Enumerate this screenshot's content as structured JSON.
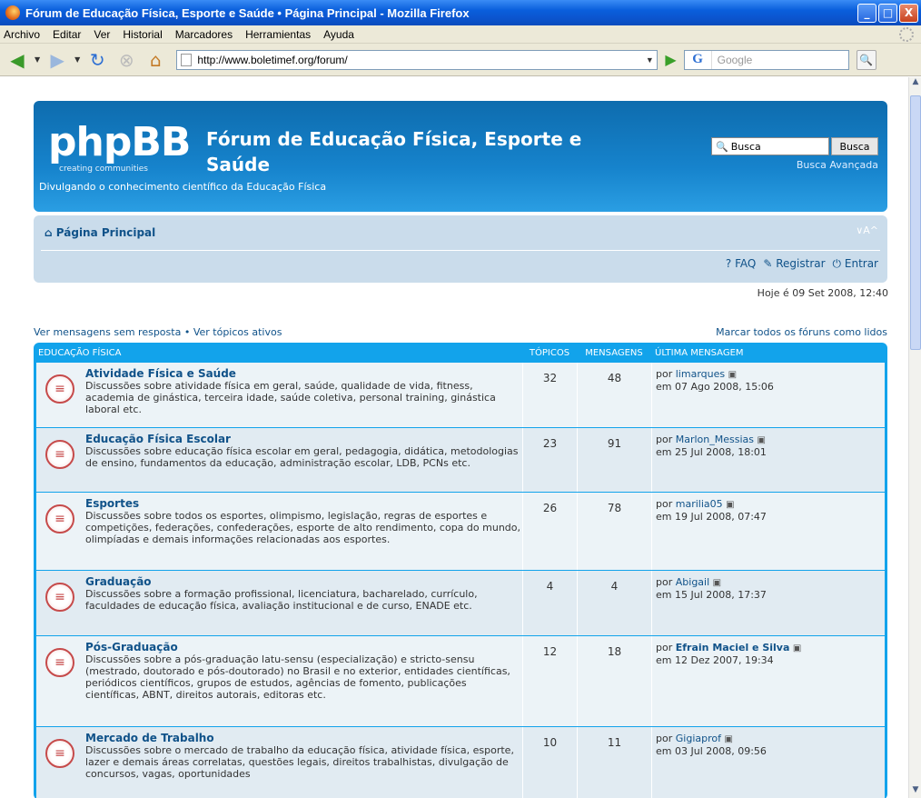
{
  "window": {
    "title": "Fórum de Educação Física, Esporte e Saúde • Página Principal - Mozilla Firefox",
    "btn_min": "_",
    "btn_max": "□",
    "btn_close": "X"
  },
  "menu": [
    {
      "label": "Archivo"
    },
    {
      "label": "Editar"
    },
    {
      "label": "Ver"
    },
    {
      "label": "Historial"
    },
    {
      "label": "Marcadores"
    },
    {
      "label": "Herramientas"
    },
    {
      "label": "Ayuda"
    }
  ],
  "toolbar": {
    "url": "http://www.boletimef.org/forum/",
    "search_placeholder": "Google",
    "search_engine": "G"
  },
  "forum": {
    "logo": "phpBB",
    "logo_sub": "creating  communities",
    "site_title": "Fórum de Educação Física, Esporte e Saúde",
    "site_desc": "Divulgando o conhecimento científico da Educação Física",
    "search_value": "Busca",
    "search_button": "Busca",
    "advanced_search": "Busca Avançada",
    "home_link": "Página Principal",
    "font_size": "∨A^",
    "faq": "FAQ",
    "register": "Registrar",
    "login": "Entrar",
    "date": "Hoje é 09 Set 2008, 12:40",
    "unanswered": "Ver mensagens sem resposta",
    "separator": "•",
    "active": "Ver tópicos ativos",
    "mark_read": "Marcar todos os fóruns como lidos"
  },
  "table": {
    "headers": {
      "name": "Educação Física",
      "topics": "Tópicos",
      "posts": "Mensagens",
      "last": "Última mensagem"
    },
    "rows": [
      {
        "title": "Atividade Física e Saúde",
        "desc": "Discussões sobre atividade física em geral, saúde, qualidade de vida, fitness, academia de ginástica, terceira idade, saúde coletiva, personal training, ginástica laboral etc.",
        "topics": "32",
        "posts": "48",
        "by": "por",
        "user": "limarques",
        "date": "em 07 Ago 2008, 15:06"
      },
      {
        "title": "Educação Física Escolar",
        "desc": "Discussões sobre educação física escolar em geral, pedagogia, didática, metodologias de ensino, fundamentos da educação, administração escolar, LDB, PCNs etc.",
        "topics": "23",
        "posts": "91",
        "by": "por",
        "user": "Marlon_Messias",
        "date": "em 25 Jul 2008, 18:01"
      },
      {
        "title": "Esportes",
        "desc": "Discussões sobre todos os esportes, olimpismo, legislação, regras de esportes e competições, federações, confederações, esporte de alto rendimento, copa do mundo, olimpíadas e demais informações relacionadas aos esportes.",
        "topics": "26",
        "posts": "78",
        "by": "por",
        "user": "marilia05",
        "date": "em 19 Jul 2008, 07:47"
      },
      {
        "title": "Graduação",
        "desc": "Discussões sobre a formação profissional, licenciatura, bacharelado, currículo, faculdades de educação física, avaliação institucional e de curso, ENADE etc.",
        "topics": "4",
        "posts": "4",
        "by": "por",
        "user": "Abigail",
        "date": "em 15 Jul 2008, 17:37"
      },
      {
        "title": "Pós-Graduação",
        "desc": "Discussões sobre a pós-graduação latu-sensu (especialização) e stricto-sensu (mestrado, doutorado e pós-doutorado) no Brasil e no exterior, entidades científicas, periódicos científicos, grupos de estudos, agências de fomento, publicações científicas, ABNT, direitos autorais, editoras etc.",
        "topics": "12",
        "posts": "18",
        "by": "por",
        "user": "Efrain Maciel e Silva",
        "date": "em 12 Dez 2007, 19:34"
      },
      {
        "title": "Mercado de Trabalho",
        "desc": "Discussões sobre o mercado de trabalho da educação física, atividade física, esporte, lazer e demais áreas correlatas, questões legais, direitos trabalhistas, divulgação de concursos, vagas, oportunidades",
        "topics": "10",
        "posts": "11",
        "by": "por",
        "user": "Gigiaprof",
        "date": "em 03 Jul 2008, 09:56"
      }
    ]
  }
}
